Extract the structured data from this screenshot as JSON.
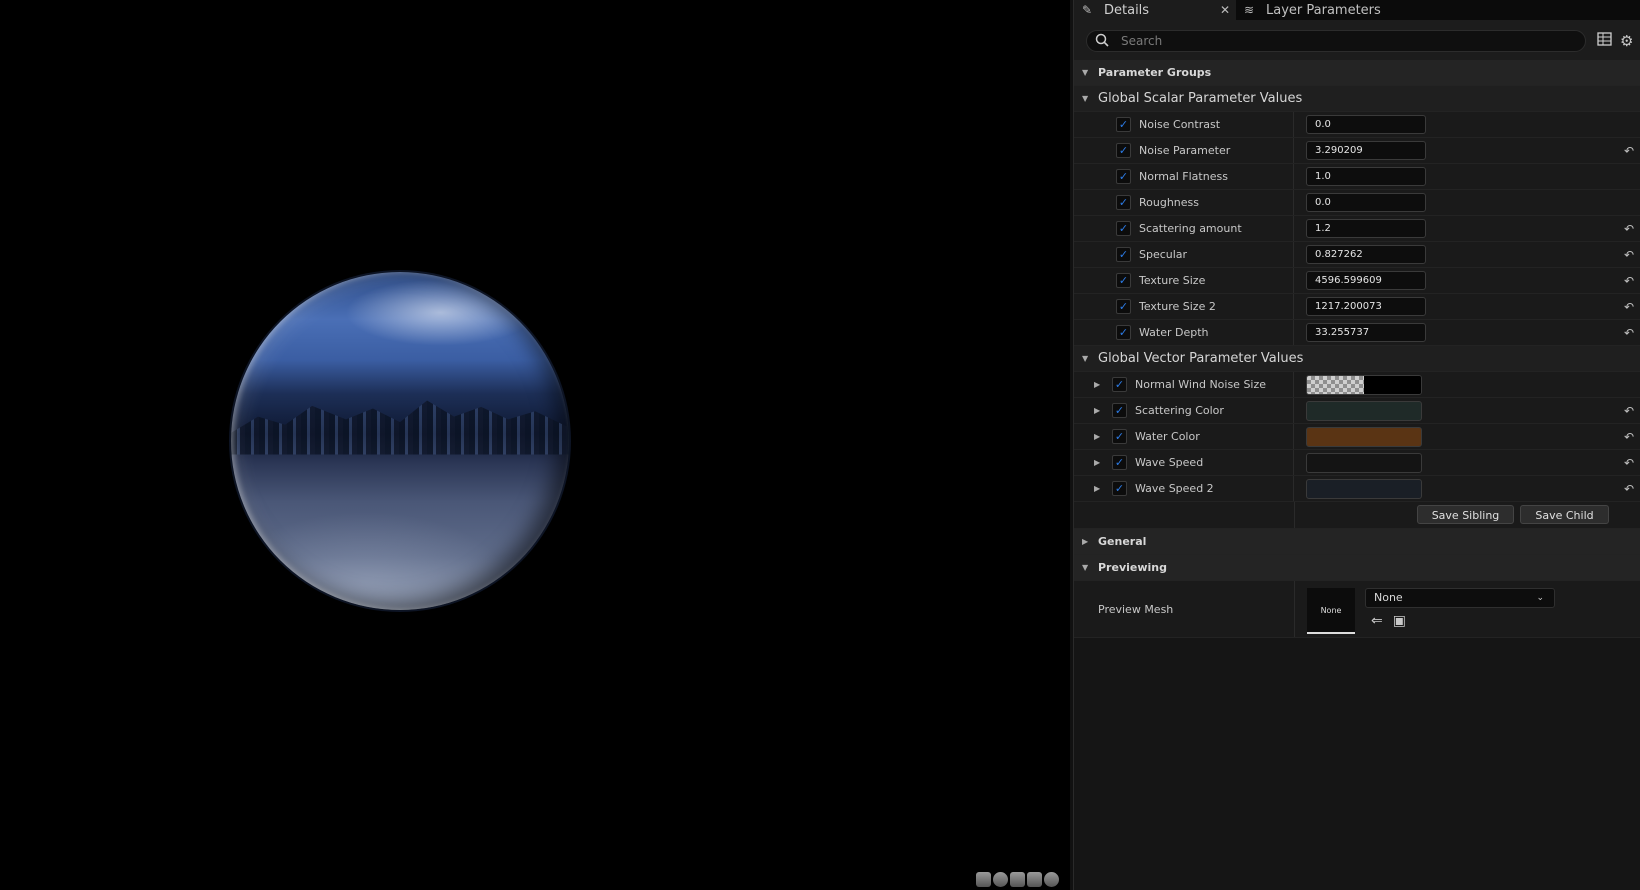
{
  "viewport": {
    "preview_shapes": [
      "cylinder-icon",
      "sphere-icon",
      "plane-icon",
      "cube-icon",
      "teapot-icon"
    ]
  },
  "tabs": [
    {
      "label": "Details",
      "icon": "pencil-icon",
      "active": true
    },
    {
      "label": "Layer Parameters",
      "icon": "layers-icon",
      "active": false
    }
  ],
  "search": {
    "placeholder": "Search"
  },
  "categories": {
    "parameter_groups": "Parameter Groups",
    "scalar": "Global Scalar Parameter Values",
    "vector": "Global Vector Parameter Values",
    "general": "General",
    "previewing": "Previewing"
  },
  "scalar_params": [
    {
      "name": "Noise Contrast",
      "value": "0.0",
      "reset": false
    },
    {
      "name": "Noise Parameter",
      "value": "3.290209",
      "reset": true
    },
    {
      "name": "Normal Flatness",
      "value": "1.0",
      "reset": false
    },
    {
      "name": "Roughness",
      "value": "0.0",
      "reset": false
    },
    {
      "name": "Scattering amount",
      "value": "1.2",
      "reset": true
    },
    {
      "name": "Specular",
      "value": "0.827262",
      "reset": true
    },
    {
      "name": "Texture Size",
      "value": "4596.599609",
      "reset": true
    },
    {
      "name": "Texture Size 2",
      "value": "1217.200073",
      "reset": true
    },
    {
      "name": "Water Depth",
      "value": "33.255737",
      "reset": true
    }
  ],
  "vector_params": [
    {
      "name": "Normal Wind Noise Size",
      "color": "#000000",
      "alpha_checker": true,
      "reset": false
    },
    {
      "name": "Scattering Color",
      "color": "#1f2a28",
      "alpha_checker": false,
      "reset": true
    },
    {
      "name": "Water Color",
      "color": "#5a3414",
      "alpha_checker": false,
      "reset": true
    },
    {
      "name": "Wave Speed",
      "color": "#141414",
      "alpha_checker": false,
      "reset": true
    },
    {
      "name": "Wave Speed 2",
      "color": "#1a1f26",
      "alpha_checker": false,
      "reset": true
    }
  ],
  "buttons": {
    "save_sibling": "Save Sibling",
    "save_child": "Save Child"
  },
  "preview_mesh": {
    "label": "Preview Mesh",
    "thumb": "None",
    "value": "None"
  },
  "colors": {
    "accent": "#2c7be5",
    "panel": "#1a1a1a"
  }
}
